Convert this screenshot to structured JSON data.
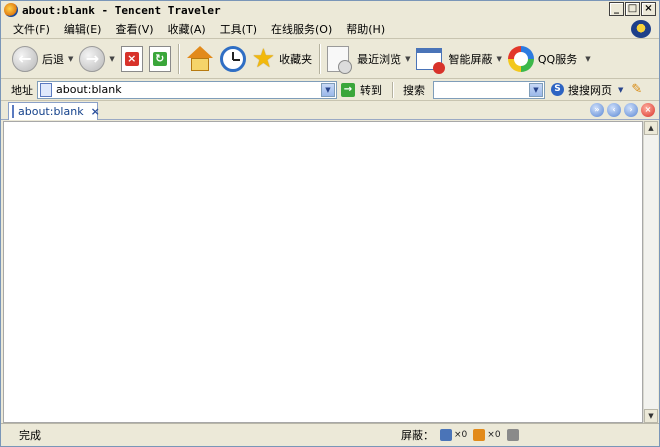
{
  "window": {
    "title": "about:blank - Tencent Traveler",
    "controls": {
      "minimize": "_",
      "maximize": "□",
      "close": "×"
    }
  },
  "menu": [
    {
      "label": "文件(F)"
    },
    {
      "label": "编辑(E)"
    },
    {
      "label": "查看(V)"
    },
    {
      "label": "收藏(A)"
    },
    {
      "label": "工具(T)"
    },
    {
      "label": "在线服务(O)"
    },
    {
      "label": "帮助(H)"
    }
  ],
  "toolbar": {
    "back_label": "后退",
    "favorites_label": "收藏夹",
    "recent_label": "最近浏览",
    "block_label": "智能屏蔽",
    "qq_label": "QQ服务"
  },
  "address": {
    "label": "地址",
    "value": "about:blank",
    "go_label": "转到",
    "search_label": "搜索",
    "search_value": "",
    "search_web_label": "搜搜网页"
  },
  "tabs": [
    {
      "label": "about:blank",
      "close": "×"
    }
  ],
  "status": {
    "text": "完成",
    "block_label": "屏蔽：",
    "popup_count": "×0",
    "ad_count": "×0"
  },
  "colors": {
    "chrome": "#ece9d8",
    "tab_text": "#15428b",
    "content_bg": "#ffffff"
  }
}
